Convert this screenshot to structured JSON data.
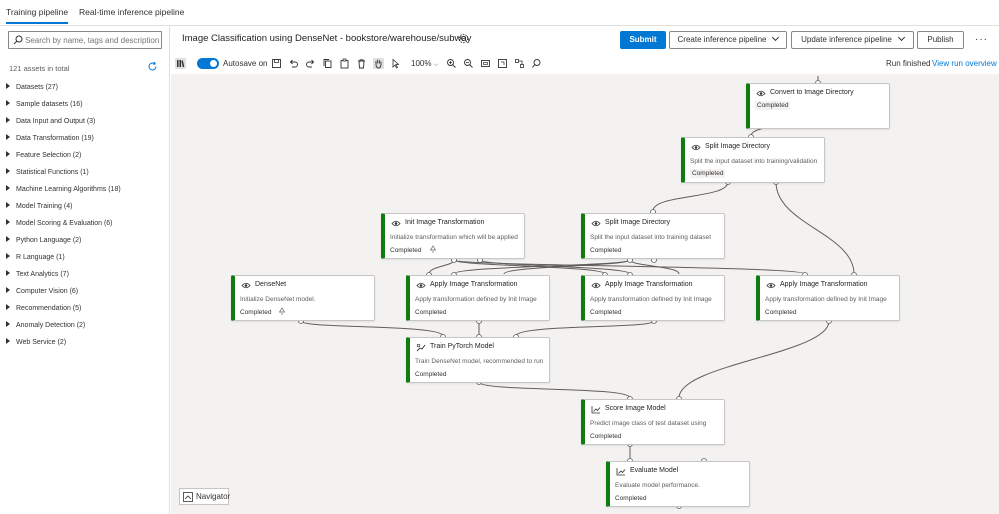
{
  "tabs": [
    {
      "label": "Training pipeline",
      "active": true
    },
    {
      "label": "Real-time inference pipeline",
      "active": false
    }
  ],
  "sidebar": {
    "search_placeholder": "Search by name, tags and description",
    "asset_count": "121 assets in total",
    "categories": [
      "Datasets (27)",
      "Sample datasets (16)",
      "Data Input and Output (3)",
      "Data Transformation (19)",
      "Feature Selection (2)",
      "Statistical Functions (1)",
      "Machine Learning Algorithms (18)",
      "Model Training (4)",
      "Model Scoring & Evaluation (6)",
      "Python Language (2)",
      "R Language (1)",
      "Text Analytics (7)",
      "Computer Vision (6)",
      "Recommendation (5)",
      "Anomaly Detection (2)",
      "Web Service (2)"
    ]
  },
  "header": {
    "title": "Image Classification using DenseNet - bookstore/warehouse/subway",
    "submit_label": "Submit",
    "create_inference_label": "Create inference pipeline",
    "update_inference_label": "Update inference pipeline",
    "publish_label": "Publish",
    "more_label": "···"
  },
  "toolbar": {
    "autosave_label": "Autosave on",
    "autosave_on": true,
    "zoom": "100%",
    "run_status": "Run finished",
    "run_link": "View run overview"
  },
  "canvas": {
    "navigator_label": "Navigator",
    "nodes": [
      {
        "id": "convert",
        "title": "Convert to Image Directory",
        "desc": "",
        "status": "Completed",
        "icon": "eye-icon"
      },
      {
        "id": "split1",
        "title": "Split Image Directory",
        "desc": "Split the input dataset into training/validation",
        "status": "Completed",
        "icon": "eye-icon"
      },
      {
        "id": "init",
        "title": "Init Image Transformation",
        "desc": "Initialize transformation which will be applied",
        "status": "Completed",
        "icon": "eye-icon"
      },
      {
        "id": "split2",
        "title": "Split Image Directory",
        "desc": "Split the input dataset into training dataset",
        "status": "Completed",
        "icon": "eye-icon"
      },
      {
        "id": "densenet",
        "title": "DenseNet",
        "desc": "Initialize DenseNet model.",
        "status": "Completed",
        "icon": "eye-icon"
      },
      {
        "id": "apply1",
        "title": "Apply Image Transformation",
        "desc": "Apply transformation defined by Init Image",
        "status": "Completed",
        "icon": "eye-icon"
      },
      {
        "id": "apply2",
        "title": "Apply Image Transformation",
        "desc": "Apply transformation defined by Init Image",
        "status": "Completed",
        "icon": "eye-icon"
      },
      {
        "id": "apply3",
        "title": "Apply Image Transformation",
        "desc": "Apply transformation defined by Init Image",
        "status": "Completed",
        "icon": "eye-icon"
      },
      {
        "id": "train",
        "title": "Train PyTorch Model",
        "desc": "Train DenseNet model, recommended to run",
        "status": "Completed",
        "icon": "train-icon"
      },
      {
        "id": "score",
        "title": "Score Image Model",
        "desc": "Predict image class of test dataset using",
        "status": "Completed",
        "icon": "chart-icon"
      },
      {
        "id": "evaluate",
        "title": "Evaluate Model",
        "desc": "Evaluate model performance.",
        "status": "Completed",
        "icon": "chart-icon"
      }
    ]
  },
  "colors": {
    "accent": "#0078d4",
    "completed_bar": "#107c10",
    "canvas_bg": "#f3f2f1"
  }
}
